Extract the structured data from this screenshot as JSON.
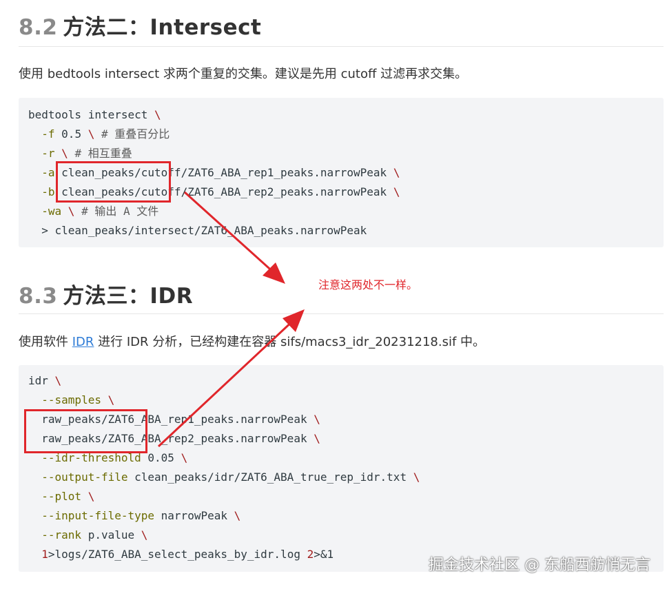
{
  "section82": {
    "num": "8.2",
    "title": "方法二：Intersect",
    "desc": "使用 bedtools intersect 求两个重复的交集。建议是先用 cutoff 过滤再求交集。",
    "code": [
      [
        {
          "t": "bedtools intersect ",
          "c": "kw"
        },
        {
          "t": "\\",
          "c": "red"
        }
      ],
      [
        {
          "t": "  -f ",
          "c": "opt"
        },
        {
          "t": "0.5 ",
          "c": "kw"
        },
        {
          "t": "\\ ",
          "c": "red"
        },
        {
          "t": "# 重叠百分比",
          "c": "c"
        }
      ],
      [
        {
          "t": "  -r ",
          "c": "opt"
        },
        {
          "t": "\\ ",
          "c": "red"
        },
        {
          "t": "# 相互重叠",
          "c": "c"
        }
      ],
      [
        {
          "t": "  -a ",
          "c": "opt"
        },
        {
          "t": "clean_peaks/cutoff/ZAT6_ABA_rep1_peaks.narrowPeak ",
          "c": "kw"
        },
        {
          "t": "\\",
          "c": "red"
        }
      ],
      [
        {
          "t": "  -b ",
          "c": "opt"
        },
        {
          "t": "clean_peaks/cutoff/ZAT6_ABA_rep2_peaks.narrowPeak ",
          "c": "kw"
        },
        {
          "t": "\\",
          "c": "red"
        }
      ],
      [
        {
          "t": "  -wa ",
          "c": "opt"
        },
        {
          "t": "\\ ",
          "c": "red"
        },
        {
          "t": "# 输出 A 文件",
          "c": "c"
        }
      ],
      [
        {
          "t": "  > clean_peaks/intersect/ZAT6_ABA_peaks.narrowPeak",
          "c": "kw"
        }
      ]
    ]
  },
  "section83": {
    "num": "8.3",
    "title": "方法三：IDR",
    "desc_before": "使用软件 ",
    "desc_link": "IDR",
    "desc_after": " 进行 IDR 分析，已经构建在容器 sifs/macs3_idr_20231218.sif 中。",
    "code": [
      [
        {
          "t": "idr ",
          "c": "kw"
        },
        {
          "t": "\\",
          "c": "red"
        }
      ],
      [
        {
          "t": "  --samples ",
          "c": "opt"
        },
        {
          "t": "\\",
          "c": "red"
        }
      ],
      [
        {
          "t": "  raw_peaks/ZAT6_ABA_rep1_peaks.narrowPeak ",
          "c": "kw"
        },
        {
          "t": "\\",
          "c": "red"
        }
      ],
      [
        {
          "t": "  raw_peaks/ZAT6_ABA_rep2_peaks.narrowPeak ",
          "c": "kw"
        },
        {
          "t": "\\",
          "c": "red"
        }
      ],
      [
        {
          "t": "  --idr-threshold ",
          "c": "opt"
        },
        {
          "t": "0.05 ",
          "c": "kw"
        },
        {
          "t": "\\",
          "c": "red"
        }
      ],
      [
        {
          "t": "  --output-file ",
          "c": "opt"
        },
        {
          "t": "clean_peaks/idr/ZAT6_ABA_true_rep_idr.txt ",
          "c": "kw"
        },
        {
          "t": "\\",
          "c": "red"
        }
      ],
      [
        {
          "t": "  --plot ",
          "c": "opt"
        },
        {
          "t": "\\",
          "c": "red"
        }
      ],
      [
        {
          "t": "  --input-file-type ",
          "c": "opt"
        },
        {
          "t": "narrowPeak ",
          "c": "kw"
        },
        {
          "t": "\\",
          "c": "red"
        }
      ],
      [
        {
          "t": "  --rank ",
          "c": "opt"
        },
        {
          "t": "p.value ",
          "c": "kw"
        },
        {
          "t": "\\",
          "c": "red"
        }
      ],
      [
        {
          "t": "  1",
          "c": "red"
        },
        {
          "t": ">logs/ZAT6_ABA_select_peaks_by_idr.log ",
          "c": "kw"
        },
        {
          "t": "2",
          "c": "red"
        },
        {
          "t": ">&1",
          "c": "kw"
        }
      ]
    ]
  },
  "annotation": "注意这两处不一样。",
  "watermark": "掘金技术社区 @ 东船西舫悄无言",
  "colors": {
    "annotation_red": "#e0262b",
    "link": "#2d7bd6"
  }
}
